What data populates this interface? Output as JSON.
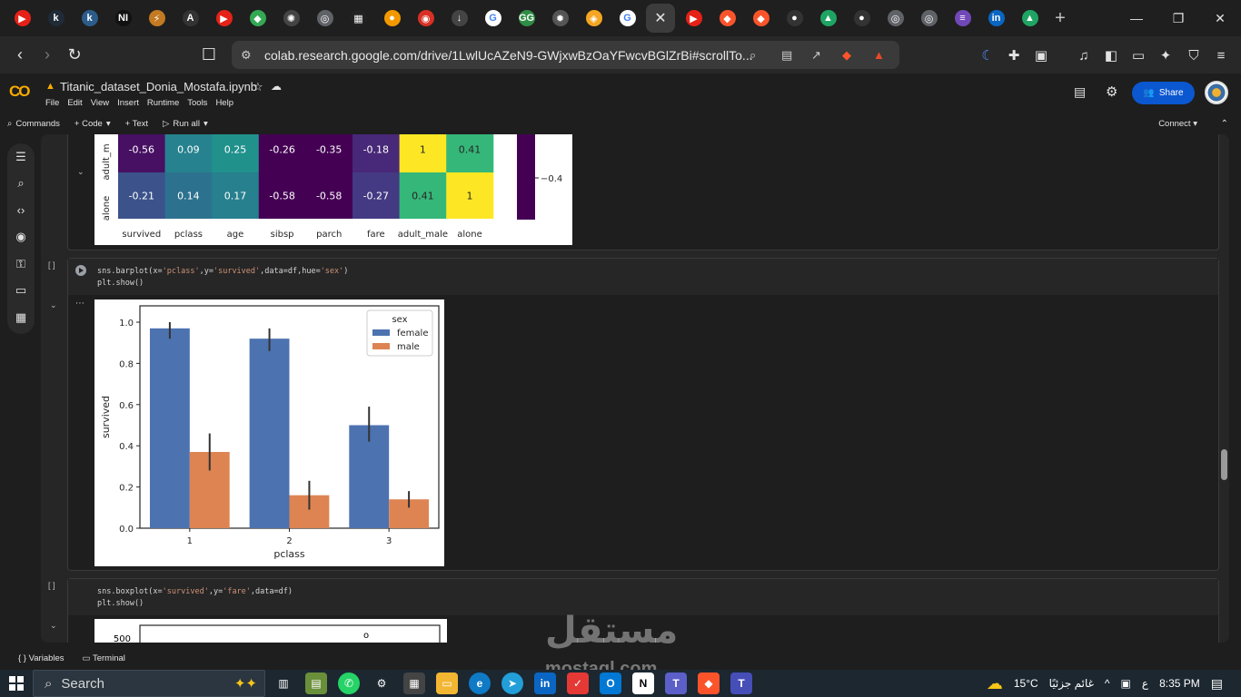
{
  "browser": {
    "tabs": [
      {
        "icon": "youtube-icon",
        "color": "#e62117",
        "glyph": "▶"
      },
      {
        "icon": "k-icon",
        "color": "#1f2b37",
        "glyph": "k"
      },
      {
        "icon": "k-circle-icon",
        "color": "#2c5c8a",
        "glyph": "k"
      },
      {
        "icon": "ni-icon",
        "color": "#111111",
        "glyph": "NI"
      },
      {
        "icon": "bolt-icon",
        "color": "#c47a22",
        "glyph": "⚡"
      },
      {
        "icon": "a-icon",
        "color": "#333333",
        "glyph": "A"
      },
      {
        "icon": "youtube-icon",
        "color": "#e62117",
        "glyph": "▶"
      },
      {
        "icon": "multicolor-icon",
        "color": "#34a853",
        "glyph": "◆"
      },
      {
        "icon": "openai-icon",
        "color": "#444444",
        "glyph": "✺"
      },
      {
        "icon": "globe-icon",
        "color": "#5f6368",
        "glyph": "◎"
      },
      {
        "icon": "pixel-icon",
        "color": "#222222",
        "glyph": "▦"
      },
      {
        "icon": "orange-circle-icon",
        "color": "#f29900",
        "glyph": "●"
      },
      {
        "icon": "red-ball-icon",
        "color": "#d93025",
        "glyph": "◉"
      },
      {
        "icon": "download-icon",
        "color": "#444444",
        "glyph": "↓"
      },
      {
        "icon": "google-icon",
        "color": "#ffffff",
        "glyph": "G"
      },
      {
        "icon": "gfg-icon",
        "color": "#2f8d46",
        "glyph": "GG"
      },
      {
        "icon": "loader-icon",
        "color": "#555555",
        "glyph": "✹"
      },
      {
        "icon": "shield-icon",
        "color": "#f5a623",
        "glyph": "◈"
      },
      {
        "icon": "google-icon",
        "color": "#ffffff",
        "glyph": "G"
      }
    ],
    "active_tab_close": "✕",
    "tabs_after": [
      {
        "icon": "youtube-icon",
        "color": "#e62117",
        "glyph": "▶"
      },
      {
        "icon": "brave-icon",
        "color": "#fb542b",
        "glyph": "◆"
      },
      {
        "icon": "brave-icon",
        "color": "#fb542b",
        "glyph": "◆"
      },
      {
        "icon": "github-icon",
        "color": "#333333",
        "glyph": "●"
      },
      {
        "icon": "drive-icon",
        "color": "#1fa463",
        "glyph": "▲"
      },
      {
        "icon": "github-icon",
        "color": "#333333",
        "glyph": "●"
      },
      {
        "icon": "globe-icon",
        "color": "#5f6368",
        "glyph": "◎"
      },
      {
        "icon": "globe-icon",
        "color": "#5f6368",
        "glyph": "◎"
      },
      {
        "icon": "forms-icon",
        "color": "#7248b9",
        "glyph": "≡"
      },
      {
        "icon": "linkedin-icon",
        "color": "#0a66c2",
        "glyph": "in"
      },
      {
        "icon": "drive-icon",
        "color": "#1fa463",
        "glyph": "▲"
      }
    ],
    "new_tab": "+",
    "url": "colab.research.google.com/drive/1LwlUcAZeN9-GWjxwBzOaYFwcvBGlZrBi#scrollTo..."
  },
  "colab": {
    "logo": "CO",
    "file_name": "Titanic_dataset_Donia_Mostafa.ipynb",
    "menu": [
      "File",
      "Edit",
      "View",
      "Insert",
      "Runtime",
      "Tools",
      "Help"
    ],
    "share_label": "Share",
    "toolbar": {
      "commands": "Commands",
      "code": "+ Code",
      "text": "+ Text",
      "run_all": "Run all",
      "connect": "Connect"
    }
  },
  "cells": {
    "exec_marker": "[ ]",
    "barplot_code": "sns.barplot(x='pclass',y='survived',data=df,hue='sex')\nplt.show()",
    "boxplot_code": "sns.boxplot(x='survived',y='fare',data=df)\nplt.show()"
  },
  "heatmap": {
    "rows": [
      {
        "label": "adult_m",
        "values": [
          "-0.56",
          "0.09",
          "0.25",
          "-0.26",
          "-0.35",
          "-0.18",
          "1",
          "0.41"
        ],
        "colors": [
          "#471063",
          "#26828e",
          "#21918c",
          "#440154",
          "#440154",
          "#482878",
          "#fde725",
          "#35b779"
        ]
      },
      {
        "label": "alone",
        "values": [
          "-0.21",
          "0.14",
          "0.17",
          "-0.58",
          "-0.58",
          "-0.27",
          "0.41",
          "1"
        ],
        "colors": [
          "#3b528b",
          "#2c728e",
          "#27808e",
          "#440154",
          "#440154",
          "#443983",
          "#35b779",
          "#fde725"
        ]
      }
    ],
    "columns": [
      "survived",
      "pclass",
      "age",
      "sibsp",
      "parch",
      "fare",
      "adult_male",
      "alone"
    ],
    "colorbar_tick": "−0.4"
  },
  "chart_data": {
    "type": "bar",
    "categories": [
      "1",
      "2",
      "3"
    ],
    "series": [
      {
        "name": "female",
        "values": [
          0.97,
          0.92,
          0.5
        ],
        "ci": [
          [
            0.92,
            1.0
          ],
          [
            0.86,
            0.97
          ],
          [
            0.42,
            0.59
          ]
        ],
        "color": "#4c72b0"
      },
      {
        "name": "male",
        "values": [
          0.37,
          0.16,
          0.14
        ],
        "ci": [
          [
            0.28,
            0.46
          ],
          [
            0.09,
            0.23
          ],
          [
            0.1,
            0.18
          ]
        ],
        "color": "#dd8452"
      }
    ],
    "xlabel": "pclass",
    "ylabel": "survived",
    "ylim": [
      0,
      1.0
    ],
    "yticks": [
      "0.0",
      "0.2",
      "0.4",
      "0.6",
      "0.8",
      "1.0"
    ],
    "legend_title": "sex",
    "legend_position": "top-right"
  },
  "boxplot_partial": {
    "ytick": "500",
    "outlier": "o"
  },
  "statusbar": {
    "variables": "Variables",
    "terminal": "Terminal"
  },
  "taskbar": {
    "search": "Search",
    "weather": "15°C",
    "weather_text": "غائم جزئيًا",
    "lang": "ع",
    "time": "8:35 PM"
  },
  "watermark": {
    "text": "مستقل",
    "domain": "mostaql.com"
  }
}
